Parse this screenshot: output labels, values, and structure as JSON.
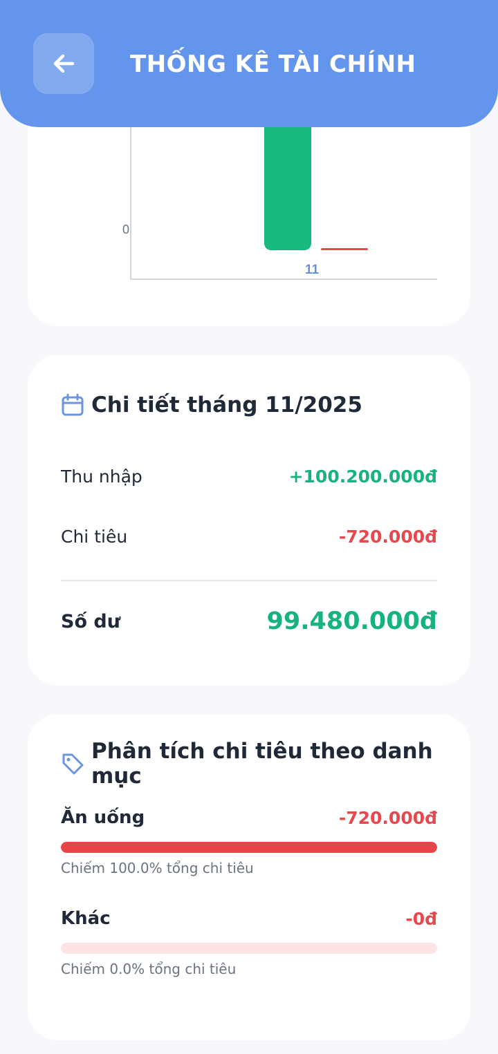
{
  "header": {
    "title": "THỐNG KÊ TÀI CHÍNH",
    "back_icon": "arrow-left-icon",
    "background": "#6495ec"
  },
  "chart_data": {
    "type": "bar",
    "categories": [
      "11"
    ],
    "y_tick_labels": [
      "0"
    ],
    "series": [
      {
        "values": [
          100200000
        ],
        "color": "#17b97f"
      },
      {
        "values": [
          720000
        ],
        "color": "#e5484d"
      }
    ]
  },
  "detail": {
    "icon": "calendar-icon",
    "title": "Chi tiết tháng 11/2025",
    "income_label": "Thu nhập",
    "income_value": "+100.200.000đ",
    "expense_label": "Chi tiêu",
    "expense_value": "-720.000đ",
    "balance_label": "Số dư",
    "balance_value": "99.480.000đ"
  },
  "categories": {
    "icon": "tag-icon",
    "title": "Phân tích chi tiêu theo danh mục",
    "items": [
      {
        "name": "Ăn uống",
        "amount": "-720.000đ",
        "percent": 100.0,
        "note": "Chiếm 100.0% tổng chi tiêu"
      },
      {
        "name": "Khác",
        "amount": "-0đ",
        "percent": 0.0,
        "note": "Chiếm 0.0% tổng chi tiêu"
      }
    ]
  },
  "colors": {
    "income": "#17b37d",
    "expense": "#e5484d",
    "accent": "#6495ec"
  }
}
